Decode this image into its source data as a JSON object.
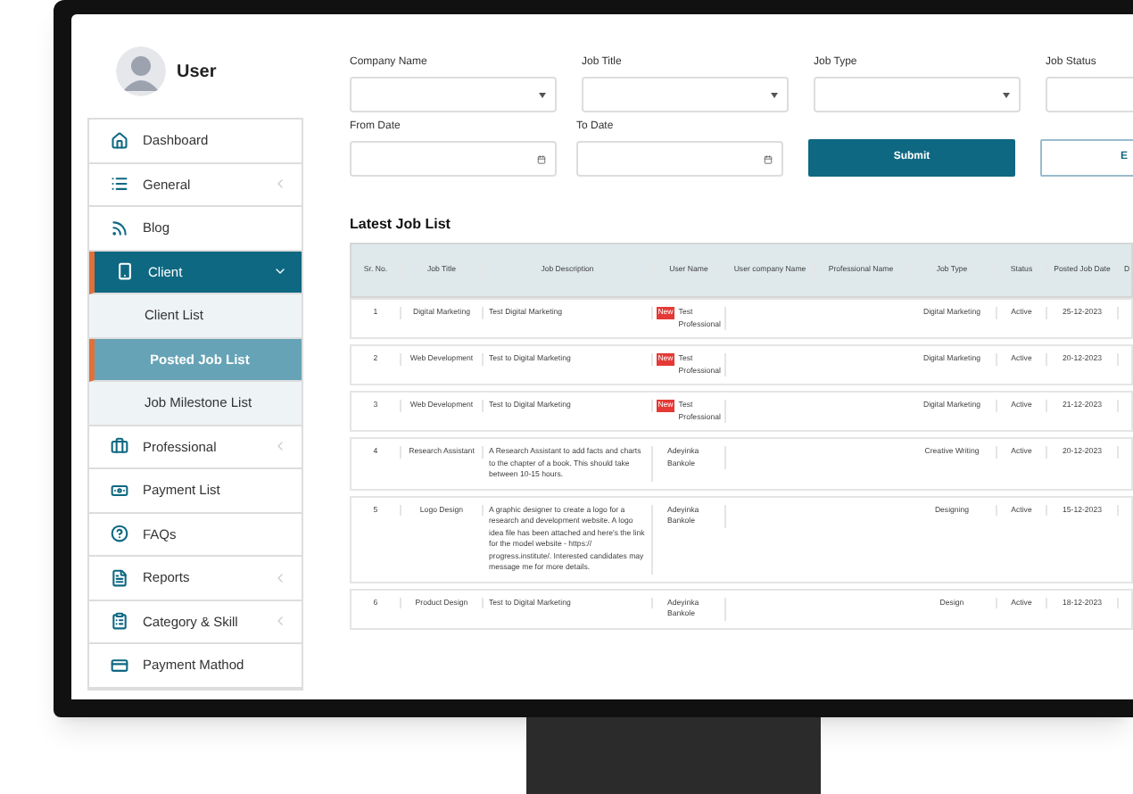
{
  "user": {
    "name": "User"
  },
  "sidebar": {
    "items": [
      {
        "label": "Dashboard",
        "kind": "link",
        "selected": false
      },
      {
        "label": "General",
        "kind": "group",
        "expanded": false,
        "selected": false
      },
      {
        "label": "Blog",
        "kind": "link",
        "selected": false
      },
      {
        "label": "Client",
        "kind": "group",
        "expanded": true,
        "selected": true,
        "children": [
          {
            "label": "Client List",
            "selected": false
          },
          {
            "label": "Posted Job List",
            "selected": true
          },
          {
            "label": "Job Milestone List",
            "selected": false
          }
        ]
      },
      {
        "label": "Professional",
        "kind": "group",
        "expanded": false,
        "selected": false
      },
      {
        "label": "Payment List",
        "kind": "link",
        "selected": false
      },
      {
        "label": "FAQs",
        "kind": "link",
        "selected": false
      },
      {
        "label": "Reports",
        "kind": "group",
        "expanded": false,
        "selected": false
      },
      {
        "label": "Category & Skill",
        "kind": "group",
        "expanded": false,
        "selected": false
      },
      {
        "label": "Payment Mathod",
        "kind": "link",
        "selected": false
      }
    ]
  },
  "filters": [
    {
      "label": "Company Name",
      "kind": "select"
    },
    {
      "label": "Job Title",
      "kind": "select"
    },
    {
      "label": "Job Type",
      "kind": "select"
    },
    {
      "label": "Job Status",
      "kind": "select"
    },
    {
      "label": "From Date",
      "kind": "date"
    },
    {
      "label": "To Date",
      "kind": "date"
    }
  ],
  "buttons": [
    {
      "label": "Submit",
      "kind": "primary"
    },
    {
      "label": "E",
      "kind": "outline"
    }
  ],
  "table": {
    "title": "Latest Job List",
    "columns": [
      "Sr. No.",
      "Job Title",
      "Job Description",
      "User Name",
      "User company Name",
      "Professional Name",
      "Job Type",
      "Status",
      "Posted Job Date",
      "D"
    ],
    "rows": [
      {
        "sr": "1",
        "job_title": "Digital Marketing",
        "description": "Test Digital Marketing",
        "user_badge": "New",
        "user_name": "Test Professional",
        "job_type": "Digital Marketing",
        "status": "Active",
        "posted_date": "25-12-2023"
      },
      {
        "sr": "2",
        "job_title": "Web Development",
        "description": "Test to Digital Marketing",
        "user_badge": "New",
        "user_name": "Test Professional",
        "job_type": "Digital Marketing",
        "status": "Active",
        "posted_date": "20-12-2023"
      },
      {
        "sr": "3",
        "job_title": "Web Development",
        "description": "Test to Digital Marketing",
        "user_badge": "New",
        "user_name": "Test Professional",
        "job_type": "Digital Marketing",
        "status": "Active",
        "posted_date": "21-12-2023"
      },
      {
        "sr": "4",
        "job_title": "Research Assistant",
        "description": "A Research Assistant to add facts and charts to the chapter of a book. This should take between 10-15 hours.",
        "user_name": "Adeyinka Bankole",
        "job_type": "Creative Writing",
        "status": "Active",
        "posted_date": "20-12-2023"
      },
      {
        "sr": "5",
        "job_title": "Logo Design",
        "description": "A graphic designer to create a logo for a research and development website. A logo idea file has been attached and here's the link for the model website - https:// progress.institute/. Interested candidates may message me for more details.",
        "user_name": "Adeyinka Bankole",
        "job_type": "Designing",
        "status": "Active",
        "posted_date": "15-12-2023"
      },
      {
        "sr": "6",
        "job_title": "Product Design",
        "description": "Test to Digital Marketing",
        "user_name": "Adeyinka Bankole",
        "job_type": "Design",
        "status": "Active",
        "posted_date": "18-12-2023"
      }
    ]
  }
}
